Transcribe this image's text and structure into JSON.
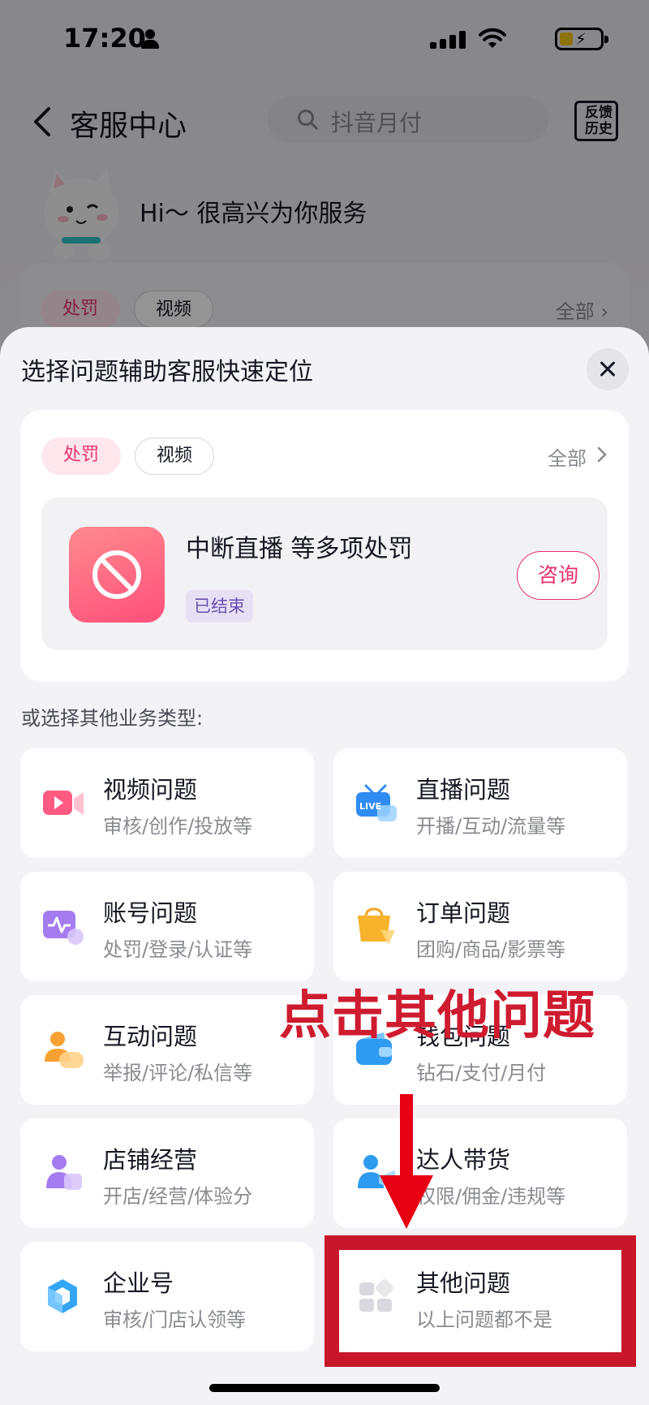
{
  "status_bar": {
    "time": "17:20"
  },
  "nav": {
    "title": "客服中心",
    "search_placeholder": "抖音月付",
    "history_label": "反馈历史"
  },
  "greeting": "Hi～ 很高兴为你服务",
  "background_card": {
    "chips": [
      "处罚",
      "视频"
    ],
    "all_label": "全部"
  },
  "sheet": {
    "title": "选择问题辅助客服快速定位",
    "punish_card": {
      "chips": [
        "处罚",
        "视频"
      ],
      "all_label": "全部",
      "item_title": "中断直播 等多项处罚",
      "status": "已结束",
      "consult_label": "咨询"
    },
    "other_label": "或选择其他业务类型:",
    "categories": [
      {
        "title": "视频问题",
        "subtitle": "审核/创作/投放等",
        "icon": "video-icon"
      },
      {
        "title": "直播问题",
        "subtitle": "开播/互动/流量等",
        "icon": "live-icon"
      },
      {
        "title": "账号问题",
        "subtitle": "处罚/登录/认证等",
        "icon": "account-icon"
      },
      {
        "title": "订单问题",
        "subtitle": "团购/商品/影票等",
        "icon": "shopping-bag-icon"
      },
      {
        "title": "互动问题",
        "subtitle": "举报/评论/私信等",
        "icon": "interaction-icon"
      },
      {
        "title": "钱包问题",
        "subtitle": "钻石/支付/月付",
        "icon": "wallet-icon"
      },
      {
        "title": "店铺经营",
        "subtitle": "开店/经营/体验分",
        "icon": "store-icon"
      },
      {
        "title": "达人带货",
        "subtitle": "权限/佣金/违规等",
        "icon": "influencer-icon"
      },
      {
        "title": "企业号",
        "subtitle": "审核/门店认领等",
        "icon": "enterprise-icon"
      },
      {
        "title": "其他问题",
        "subtitle": "以上问题都不是",
        "icon": "grid-icon"
      }
    ]
  },
  "annotation": {
    "text": "点击其他问题"
  },
  "colors": {
    "accent": "#e8306b",
    "annotation_red": "#c8162b",
    "status_tag_bg": "#e7e0f5"
  }
}
